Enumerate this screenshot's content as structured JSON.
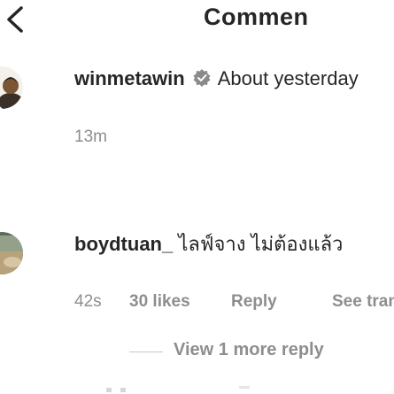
{
  "header": {
    "back_icon": "chevron-left-icon",
    "title": "Commen"
  },
  "comment": {
    "username": "winmetawin",
    "badge_icon": "verified-badge-icon",
    "text": "About yesterday",
    "time": "13m"
  },
  "reply": {
    "username": "boydtuan_",
    "text": "ไลฟ์จาง ไม่ต้องแล้ว",
    "time": "42s",
    "likes": "30 likes",
    "reply_label": "Reply",
    "see_translation": "See trans"
  },
  "view_more": {
    "label": "View 1 more reply"
  },
  "colors": {
    "text": "#262626",
    "muted": "#8e8e8e",
    "background": "#ffffff"
  }
}
